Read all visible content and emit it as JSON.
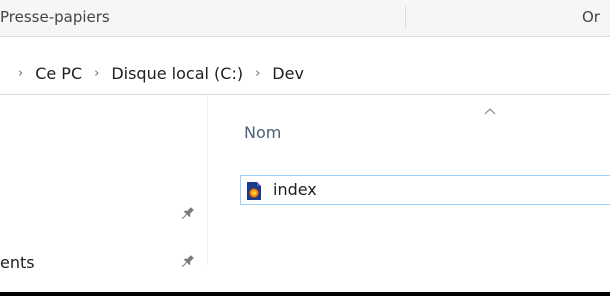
{
  "ribbon": {
    "clipboard_label": "Presse-papiers",
    "organize_label": "Or"
  },
  "breadcrumb": {
    "items": [
      "Ce PC",
      "Disque local (C:)",
      "Dev"
    ],
    "separator": "›"
  },
  "nav_pane": {
    "items": [
      {
        "label": "",
        "pinned": true
      },
      {
        "label": "ents",
        "pinned": true
      }
    ]
  },
  "file_list": {
    "column_name": "Nom",
    "sort": "ascending",
    "files": [
      {
        "name": "index",
        "icon": "firefox-html-file-icon",
        "selected": true
      }
    ]
  },
  "colors": {
    "selection_border": "#99d1ff",
    "header_text": "#4c607a",
    "ribbon_bg": "#f5f6f7"
  }
}
